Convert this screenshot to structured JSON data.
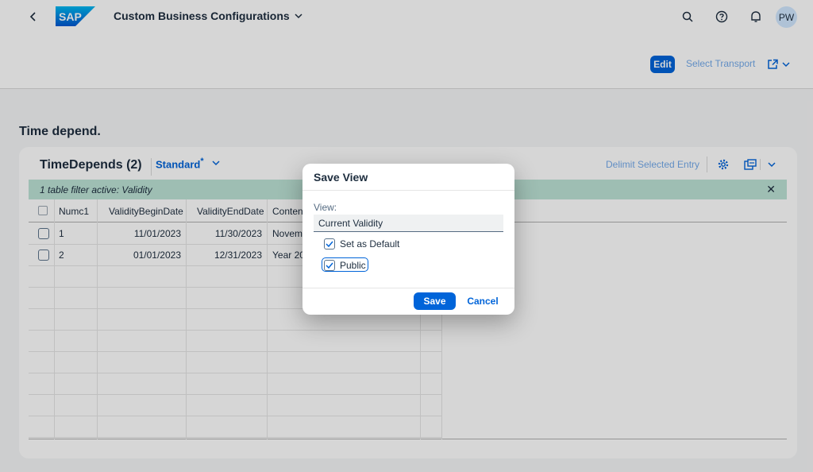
{
  "shell": {
    "logo_text": "SAP",
    "app_title": "Custom Business Configurations",
    "avatar_initials": "PW",
    "icons": [
      "back-icon",
      "search-icon",
      "help-icon",
      "notification-icon"
    ]
  },
  "header": {
    "edit_label": "Edit",
    "transport_label": "Select Transport"
  },
  "section_title": "Time depend.",
  "table": {
    "title": "TimeDepends (2)",
    "variant": "Standard",
    "variant_marker": "*",
    "delimit_label": "Delimit Selected Entry",
    "filter_info": "1 table filter active: Validity",
    "columns": [
      "Numc1",
      "ValidityBeginDate",
      "ValidityEndDate",
      "Conten"
    ],
    "rows": [
      {
        "numc1": "1",
        "begin": "11/01/2023",
        "end": "11/30/2023",
        "content": "Novem"
      },
      {
        "numc1": "2",
        "begin": "01/01/2023",
        "end": "12/31/2023",
        "content": "Year 20"
      }
    ]
  },
  "dialog": {
    "title": "Save View",
    "view_label": "View:",
    "view_value": "Current Validity",
    "set_default_label": "Set as Default",
    "set_default_checked": true,
    "public_label": "Public",
    "public_checked": true,
    "save_label": "Save",
    "cancel_label": "Cancel"
  },
  "colors": {
    "brand": "#0064d9",
    "filter_bg": "#bde3d6"
  }
}
